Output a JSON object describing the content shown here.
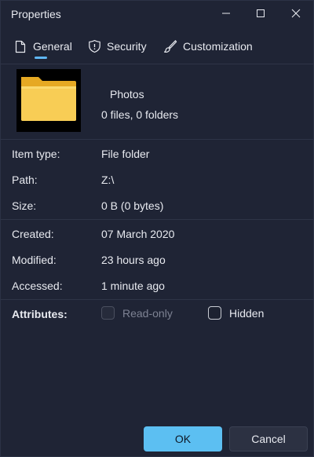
{
  "window": {
    "title": "Properties"
  },
  "tabs": [
    {
      "label": "General",
      "icon": "document-icon",
      "selected": true
    },
    {
      "label": "Security",
      "icon": "shield-icon",
      "selected": false
    },
    {
      "label": "Customization",
      "icon": "brush-icon",
      "selected": false
    }
  ],
  "header": {
    "name": "Photos",
    "stats": "0 files, 0 folders",
    "thumbnail_icon": "folder-icon",
    "folder_color": "#f5c242"
  },
  "details": {
    "item_type": {
      "label": "Item type:",
      "value": "File folder"
    },
    "path": {
      "label": "Path:",
      "value": "Z:\\"
    },
    "size": {
      "label": "Size:",
      "value": "0 B (0 bytes)"
    },
    "created": {
      "label": "Created:",
      "value": "07 March 2020"
    },
    "modified": {
      "label": "Modified:",
      "value": "23 hours ago"
    },
    "accessed": {
      "label": "Accessed:",
      "value": "1 minute ago"
    }
  },
  "attributes": {
    "label": "Attributes:",
    "read_only": {
      "label": "Read-only",
      "checked": false,
      "disabled": true
    },
    "hidden": {
      "label": "Hidden",
      "checked": false,
      "disabled": false
    }
  },
  "footer": {
    "ok_label": "OK",
    "cancel_label": "Cancel"
  },
  "colors": {
    "accent": "#5cbff2",
    "background": "#1f2435"
  }
}
